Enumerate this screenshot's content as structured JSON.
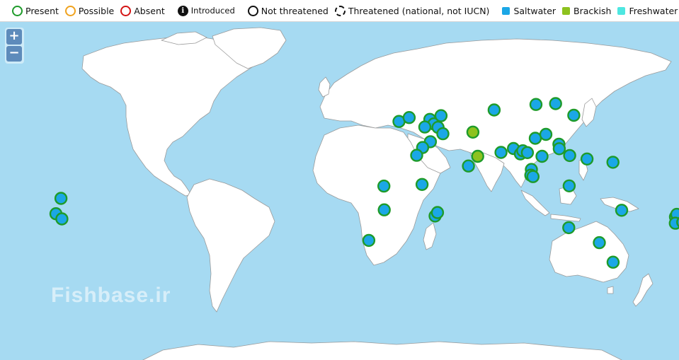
{
  "legend": {
    "present": "Present",
    "possible": "Possible",
    "absent": "Absent",
    "introduced": "Introduced",
    "not_threatened": "Not threatened",
    "threatened": "Threatened (national, not IUCN)",
    "saltwater": "Saltwater",
    "brackish": "Brackish",
    "freshwater": "Freshwater",
    "info_glyph": "i"
  },
  "zoom": {
    "in_label": "+",
    "out_label": "−"
  },
  "watermark": "Fishbase.ir",
  "colors": {
    "ocean": "#a6daf2",
    "land": "#ffffff",
    "present_ring": "#1e9b2a",
    "possible_ring": "#f0a21d",
    "absent_ring": "#d41414",
    "saltwater": "#1ba7e6",
    "brackish": "#8dc21f",
    "freshwater": "#4ee7e1"
  },
  "occurrences": [
    {
      "lon": 32.5,
      "lat": 26.3,
      "habitat": "saltwater"
    },
    {
      "lon": 38.0,
      "lat": 28.2,
      "habitat": "saltwater"
    },
    {
      "lon": 49.1,
      "lat": 27.3,
      "habitat": "saltwater"
    },
    {
      "lon": 51.2,
      "lat": 25.1,
      "habitat": "saltwater"
    },
    {
      "lon": 55.1,
      "lat": 29.1,
      "habitat": "saltwater"
    },
    {
      "lon": 46.4,
      "lat": 23.6,
      "habitat": "saltwater"
    },
    {
      "lon": 53.5,
      "lat": 23.4,
      "habitat": "saltwater"
    },
    {
      "lon": 56.1,
      "lat": 20.3,
      "habitat": "saltwater"
    },
    {
      "lon": 49.4,
      "lat": 16.4,
      "habitat": "saltwater"
    },
    {
      "lon": 45.2,
      "lat": 13.6,
      "habitat": "saltwater"
    },
    {
      "lon": 42.0,
      "lat": 9.8,
      "habitat": "saltwater"
    },
    {
      "lon": 83.6,
      "lat": 31.9,
      "habitat": "saltwater"
    },
    {
      "lon": 106.1,
      "lat": 34.6,
      "habitat": "saltwater"
    },
    {
      "lon": 116.6,
      "lat": 35.0,
      "habitat": "saltwater"
    },
    {
      "lon": 126.4,
      "lat": 29.3,
      "habitat": "saltwater"
    },
    {
      "lon": 72.2,
      "lat": 21.1,
      "habitat": "brackish"
    },
    {
      "lon": 74.8,
      "lat": 9.3,
      "habitat": "brackish"
    },
    {
      "lon": 69.8,
      "lat": 4.6,
      "habitat": "saltwater"
    },
    {
      "lon": 87.3,
      "lat": 11.2,
      "habitat": "saltwater"
    },
    {
      "lon": 94.0,
      "lat": 13.1,
      "habitat": "saltwater"
    },
    {
      "lon": 97.7,
      "lat": 10.5,
      "habitat": "saltwater"
    },
    {
      "lon": 99.0,
      "lat": 12.0,
      "habitat": "saltwater"
    },
    {
      "lon": 101.5,
      "lat": 11.1,
      "habitat": "saltwater"
    },
    {
      "lon": 105.7,
      "lat": 18.1,
      "habitat": "saltwater"
    },
    {
      "lon": 111.4,
      "lat": 20.0,
      "habitat": "saltwater"
    },
    {
      "lon": 109.3,
      "lat": 9.3,
      "habitat": "saltwater"
    },
    {
      "lon": 118.4,
      "lat": 15.2,
      "habitat": "saltwater"
    },
    {
      "lon": 118.6,
      "lat": 13.0,
      "habitat": "saltwater"
    },
    {
      "lon": 124.2,
      "lat": 9.7,
      "habitat": "saltwater"
    },
    {
      "lon": 103.6,
      "lat": 2.9,
      "habitat": "saltwater"
    },
    {
      "lon": 103.3,
      "lat": 0.1,
      "habitat": "saltwater"
    },
    {
      "lon": 104.5,
      "lat": -0.6,
      "habitat": "saltwater"
    },
    {
      "lon": 133.5,
      "lat": 8.0,
      "habitat": "saltwater"
    },
    {
      "lon": 147.4,
      "lat": 6.4,
      "habitat": "saltwater"
    },
    {
      "lon": 123.9,
      "lat": -5.1,
      "habitat": "saltwater"
    },
    {
      "lon": 24.4,
      "lat": -5.2,
      "habitat": "saltwater"
    },
    {
      "lon": 44.9,
      "lat": -4.4,
      "habitat": "saltwater"
    },
    {
      "lon": 24.6,
      "lat": -16.8,
      "habitat": "saltwater"
    },
    {
      "lon": 51.9,
      "lat": -19.8,
      "habitat": "saltwater"
    },
    {
      "lon": 53.2,
      "lat": -18.1,
      "habitat": "saltwater"
    },
    {
      "lon": 16.3,
      "lat": -31.7,
      "habitat": "saltwater"
    },
    {
      "lon": 123.7,
      "lat": -25.5,
      "habitat": "saltwater"
    },
    {
      "lon": 152.1,
      "lat": -17.0,
      "habitat": "saltwater"
    },
    {
      "lon": 140.1,
      "lat": -32.8,
      "habitat": "saltwater"
    },
    {
      "lon": 147.5,
      "lat": -42.3,
      "habitat": "saltwater"
    },
    {
      "lon": 181.0,
      "lat": -20.2,
      "habitat": "saltwater"
    },
    {
      "lon": 181.7,
      "lat": -19.0,
      "habitat": "saltwater"
    },
    {
      "lon": 180.9,
      "lat": -23.3,
      "habitat": "saltwater"
    },
    {
      "lon": 184.9,
      "lat": -22.8,
      "habitat": "saltwater"
    },
    {
      "lon": 211.0,
      "lat": -11.2,
      "habitat": "saltwater"
    },
    {
      "lon": 208.3,
      "lat": -18.7,
      "habitat": "saltwater"
    },
    {
      "lon": 211.5,
      "lat": -21.2,
      "habitat": "saltwater"
    }
  ]
}
